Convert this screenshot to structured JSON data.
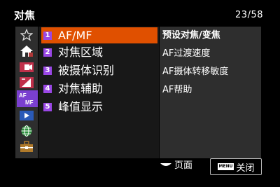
{
  "header": {
    "title": "对焦",
    "page": "23/58"
  },
  "categories": [
    {
      "icon": "star-icon"
    },
    {
      "icon": "home-icon"
    },
    {
      "icon": "camera-icon"
    },
    {
      "icon": "exposure-icon"
    },
    {
      "icon": "af-mf-icon",
      "label_top": "AF",
      "label_bottom": "MF",
      "selected": true
    },
    {
      "icon": "playback-icon"
    },
    {
      "icon": "network-icon"
    },
    {
      "icon": "toolbox-icon"
    }
  ],
  "menu": {
    "items": [
      {
        "num": "1",
        "label": "AF/MF",
        "selected": true
      },
      {
        "num": "2",
        "label": "对焦区域"
      },
      {
        "num": "3",
        "label": "被摄体识别"
      },
      {
        "num": "4",
        "label": "对焦辅助"
      },
      {
        "num": "5",
        "label": "峰值显示"
      }
    ]
  },
  "submenu": [
    "预设对焦/变焦",
    "AF过渡速度",
    "AF摄体转移敏度",
    "AF帮助"
  ],
  "footer": {
    "page_hint": "页面",
    "menu_badge": "MENU",
    "close_label": "关闭"
  },
  "colors": {
    "accent": "#e05000",
    "category_selected": "#7a3fd0",
    "number_badge": "#9a47e6"
  }
}
